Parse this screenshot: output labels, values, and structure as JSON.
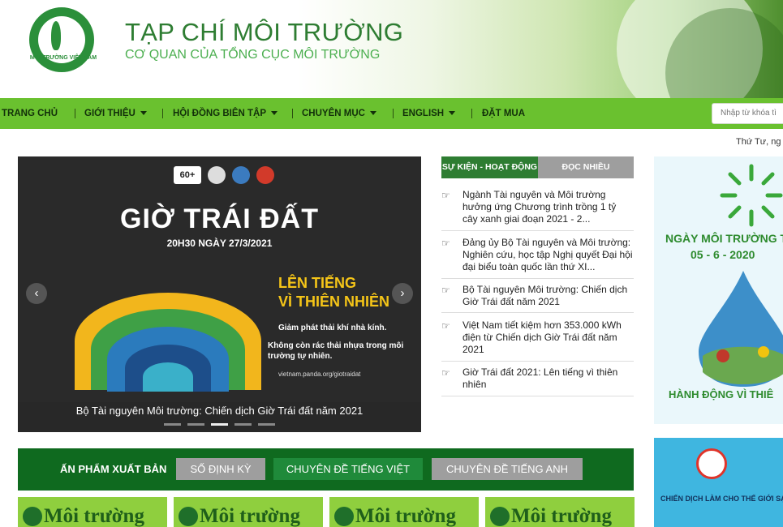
{
  "header": {
    "logo_caption": "MÔI TRƯỜNG VIỆT NAM",
    "title": "TẠP CHÍ MÔI TRƯỜNG",
    "subtitle": "CƠ QUAN CỦA TỔNG CỤC MÔI TRƯỜNG"
  },
  "nav": {
    "items": [
      {
        "label": "TRANG CHỦ"
      },
      {
        "label": "GIỚI THIỆU"
      },
      {
        "label": "HỘI ĐỒNG BIÊN TẬP"
      },
      {
        "label": "CHUYÊN MỤC"
      },
      {
        "label": "ENGLISH"
      },
      {
        "label": "ĐẶT MUA"
      }
    ],
    "search_placeholder": "Nhập từ khóa tì"
  },
  "date_text": "Thứ Tư, ng",
  "slider": {
    "badge": "60+",
    "title": "GIỜ TRÁI ĐẤT",
    "date": "20H30 NGÀY 27/3/2021",
    "headline_line1": "LÊN TIẾNG",
    "headline_line2": "VÌ THIÊN NHIÊN",
    "point1": "Giảm phát thải khí nhà kính.",
    "point2": "Không còn rác thải nhựa trong môi trường tự nhiên.",
    "url": "vietnam.panda.org/giotraidat",
    "caption": "Bộ Tài nguyên Môi trường: Chiến dịch Giờ Trái đất năm 2021",
    "prev_icon": "‹",
    "next_icon": "›",
    "active_dot_index": 2
  },
  "tabs": {
    "events": "SỰ KIỆN - HOẠT ĐỘNG",
    "most_read": "ĐỌC NHIỀU"
  },
  "news": [
    {
      "title": "Ngành Tài nguyên và Môi trường hưởng ứng Chương trình trồng 1 tỷ cây xanh giai đoạn 2021 - 2..."
    },
    {
      "title": "Đảng ủy Bộ Tài nguyên và Môi trường: Nghiên cứu, học tập Nghị quyết Đại hội đại biểu toàn quốc lần thứ XI..."
    },
    {
      "title": "Bộ Tài nguyên Môi trường: Chiến dịch Giờ Trái đất năm 2021"
    },
    {
      "title": "Việt Nam tiết kiệm hơn 353.000 kWh điện từ Chiến dịch Giờ Trái đất năm 2021"
    },
    {
      "title": "Giờ Trái đất 2021: Lên tiếng vì thiên nhiên"
    }
  ],
  "publications": {
    "label": "ẤN PHẨM XUẤT BẢN",
    "periodic": "SỐ ĐỊNH KỲ",
    "vietnamese": "CHUYÊN ĐỀ TIẾNG VIỆT",
    "english": "CHUYÊN ĐỀ TIẾNG ANH",
    "magazine_title": "Môi trường"
  },
  "banner1": {
    "title": "NGÀY MÔI TRƯỜNG T",
    "date": "05 - 6 - 2020",
    "bottom": "HÀNH ĐỘNG VÌ THIÊ"
  },
  "banner2": {
    "text": "CHIẾN DỊCH LÀM CHO THẾ GIỚI SẠCH"
  }
}
